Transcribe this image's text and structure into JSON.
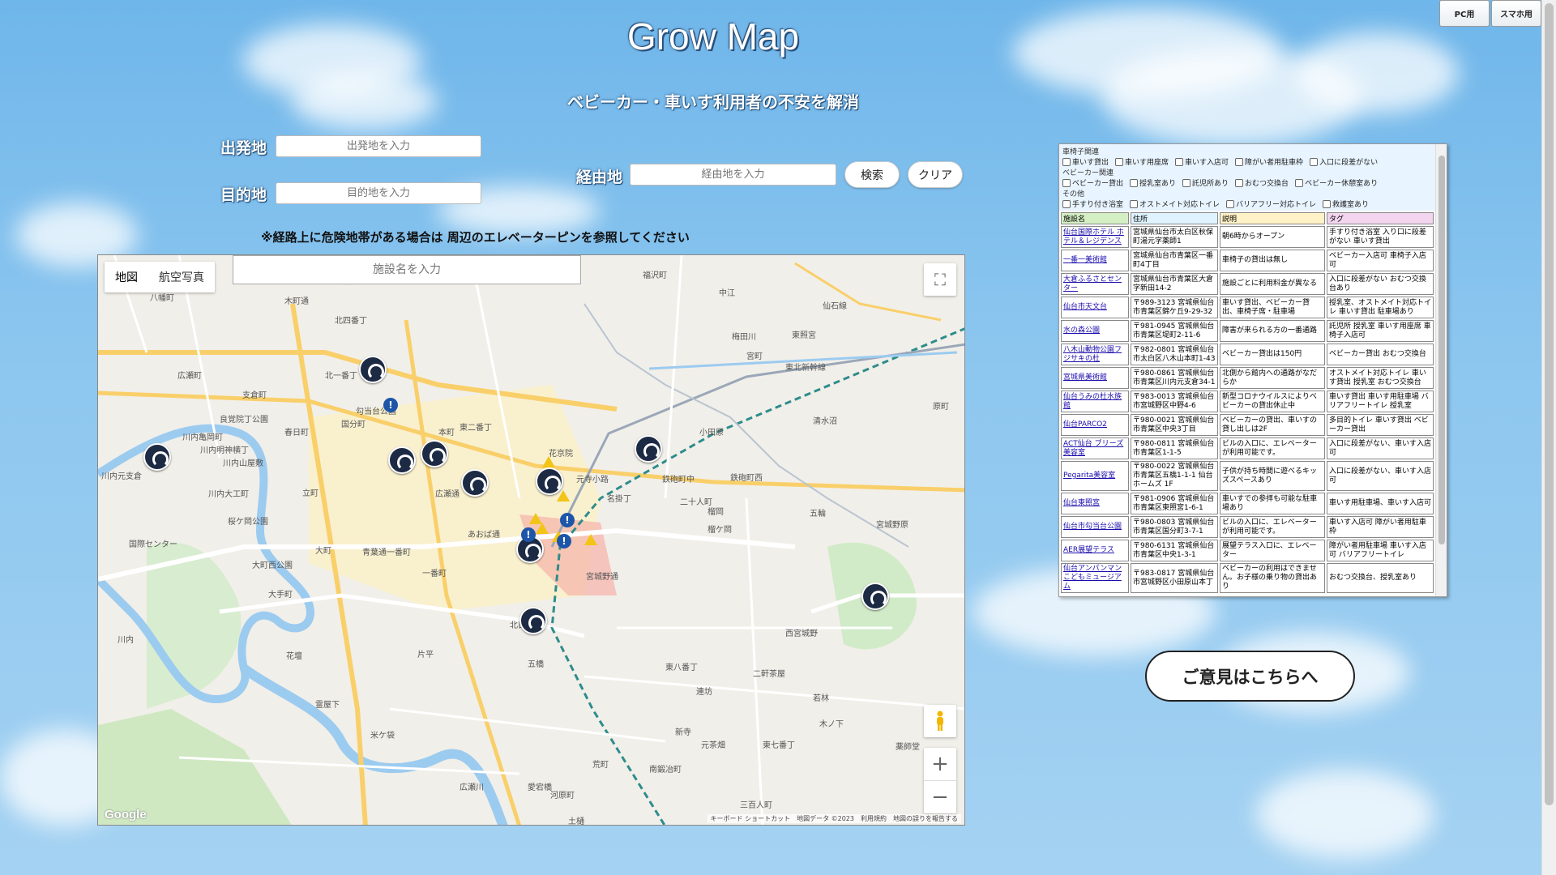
{
  "header": {
    "title": "Grow Map",
    "subtitle": "ベビーカー・車いす利用者の不安を解消",
    "pc_button": "PC用",
    "sp_button": "スマホ用"
  },
  "route": {
    "origin_label": "出発地",
    "origin_placeholder": "出発地を入力",
    "destination_label": "目的地",
    "destination_placeholder": "目的地を入力",
    "waypoint_label": "経由地",
    "waypoint_placeholder": "経由地を入力",
    "search_button": "検索",
    "clear_button": "クリア",
    "notice": "※経路上に危険地帯がある場合は 周辺のエレベーターピンを参照してください"
  },
  "map": {
    "type_map": "地図",
    "type_satellite": "航空写真",
    "facility_search_placeholder": "施設名を入力",
    "zoom_in": "+",
    "zoom_out": "−",
    "google_logo": "Google",
    "attribution": "キーボード ショートカット　地図データ ©2023　利用規約　地図の誤りを報告する",
    "places": [
      "木町通",
      "北四番丁",
      "支倉町",
      "春日町",
      "国分町",
      "川内亀岡町",
      "川内明神横丁",
      "川内山屋敷",
      "川内元支倉",
      "広瀬町",
      "立町",
      "大町",
      "一番町",
      "川内大工町",
      "桜ケ岡公園",
      "国際センター",
      "大町西公園",
      "大手町",
      "川内",
      "花壇",
      "片平",
      "五橋",
      "北目町",
      "霊屋下",
      "米ケ袋",
      "良覚院丁公園",
      "本町",
      "花京院",
      "名掛丁",
      "元寺小路",
      "鉄砲町中",
      "鉄砲町西",
      "二十人町",
      "榴ケ岡",
      "宮城野通",
      "宮城野原",
      "榴岡",
      "五輪",
      "小田原",
      "清水沼",
      "原町",
      "福沢町",
      "中江",
      "梅田川",
      "宮町",
      "連坊",
      "新寺",
      "東八番丁",
      "元茶畑",
      "東七番丁",
      "若林",
      "南鍛冶町",
      "河原町",
      "三百人町",
      "木ノ下",
      "二軒茶屋",
      "西宮城野",
      "薬師堂",
      "荒町",
      "土樋",
      "愛宕橋",
      "広瀬川",
      "勾当台公園",
      "東二番丁",
      "北一番丁",
      "仙石線",
      "東北新幹線",
      "青葉通一番町",
      "あおば通",
      "広瀬通",
      "八幡町",
      "東照宮"
    ]
  },
  "filters": {
    "wheelchair_group": "車椅子関連",
    "wheelchair": [
      "車いす貸出",
      "車いす用座席",
      "車いす入店可",
      "障がい者用駐車枠",
      "入口に段差がない"
    ],
    "baby_group": "ベビーカー関連",
    "baby": [
      "ベビーカー貸出",
      "授乳室あり",
      "託児所あり",
      "おむつ交換台",
      "ベビーカー休憩室あり"
    ],
    "other_group": "その他",
    "other": [
      "手すり付き浴室",
      "オストメイト対応トイレ",
      "バリアフリー対応トイレ",
      "救護室あり"
    ]
  },
  "facility_table": {
    "headers": [
      "施設名",
      "住所",
      "説明",
      "タグ"
    ],
    "rows": [
      {
        "name": "仙台国際ホテル ホテル＆レジデンス",
        "addr": "宮城県仙台市太白区秋保町湯元字薬師1",
        "desc": "朝6時からオープン",
        "tag": "手すり付き浴室 入り口に段差がない 車いす貸出"
      },
      {
        "name": "一番一美術館",
        "addr": "宮城県仙台市青葉区一番町4丁目",
        "desc": "車椅子の貸出は無し",
        "tag": "ベビーカー入店可 車椅子入店可"
      },
      {
        "name": "大倉ふるさとセンター",
        "addr": "宮城県仙台市青葉区大倉字新田14-2",
        "desc": "施設ごとに利用料金が異なる",
        "tag": "入口に段差がない おむつ交換台あり"
      },
      {
        "name": "仙台市天文台",
        "addr": "〒989-3123 宮城県仙台市青葉区錦ケ丘9-29-32",
        "desc": "車いす貸出、ベビーカー貸出、車椅子席・駐車場",
        "tag": "授乳室、オストメイト対応トイレ 車いす貸出 駐車場あり"
      },
      {
        "name": "水の森公園",
        "addr": "〒981-0945 宮城県仙台市青葉区堤町2-11-6",
        "desc": "障害が来られる方の一番通路",
        "tag": "託児所 授乳室 車いす用座席 車椅子入店可"
      },
      {
        "name": "八木山動物公園フジサキの杜",
        "addr": "〒982-0801 宮城県仙台市太白区八木山本町1-43",
        "desc": "ベビーカー貸出は150円",
        "tag": "ベビーカー貸出 おむつ交換台"
      },
      {
        "name": "宮城県美術館",
        "addr": "〒980-0861 宮城県仙台市青葉区川内元支倉34-1",
        "desc": "北側から館内への通路がなだらか",
        "tag": "オストメイト対応トイレ 車いす貸出 授乳室 おむつ交換台"
      },
      {
        "name": "仙台うみの杜水族館",
        "addr": "〒983-0013 宮城県仙台市宮城野区中野4-6",
        "desc": "新型コロナウイルスによりベビーカーの貸出休止中",
        "tag": "車いす貸出 車いす用駐車場 バリアフリートイレ 授乳室"
      },
      {
        "name": "仙台PARCO2",
        "addr": "〒980-0021 宮城県仙台市青葉区中央3丁目",
        "desc": "ベビーカーの貸出、車いすの貸し出しは2F",
        "tag": "多目的トイレ 車いす貸出 ベビーカー貸出"
      },
      {
        "name": "ACT仙台 ブリーズ美容室",
        "addr": "〒980-0811 宮城県仙台市青葉区1-1-5",
        "desc": "ビルの入口に、エレベーターが利用可能です。",
        "tag": "入口に段差がない、車いす入店可"
      },
      {
        "name": "Pegarita美容室",
        "addr": "〒980-0022 宮城県仙台市青葉区五橋1-1-1 仙台ホームズ 1F",
        "desc": "子供が持ち時間に遊べるキッズスペースあり",
        "tag": "入口に段差がない、車いす入店可"
      },
      {
        "name": "仙台東照宮",
        "addr": "〒981-0906 宮城県仙台市青葉区東照宮1-6-1",
        "desc": "車いすでの参拝も可能な駐車場あり",
        "tag": "車いす用駐車場、車いす入店可"
      },
      {
        "name": "仙台市勾当台公園",
        "addr": "〒980-0803 宮城県仙台市青葉区国分町3-7-1",
        "desc": "ビルの入口に、エレベーターが利用可能です。",
        "tag": "車いす入店可 障がい者用駐車枠"
      },
      {
        "name": "AER展望テラス",
        "addr": "〒980-6131 宮城県仙台市青葉区中央1-3-1",
        "desc": "展望テラス入口に、エレベーター",
        "tag": "障がい者用駐車場 車いす入店可 バリアフリートイレ"
      },
      {
        "name": "仙台アンパンマンこどもミュージアム",
        "addr": "〒983-0817 宮城県仙台市宮城野区小田原山本丁",
        "desc": "ベビーカーの利用はできません。お子様の乗り物の貸出あり",
        "tag": "おむつ交換台、授乳室あり"
      }
    ]
  },
  "feedback_button": "ご意見はこちらへ"
}
